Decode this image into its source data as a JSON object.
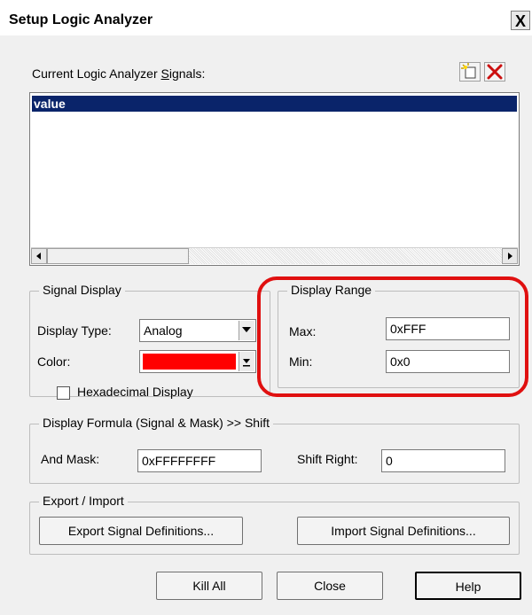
{
  "window": {
    "title": "Setup Logic Analyzer",
    "close_glyph": "X"
  },
  "signals": {
    "label_prefix": "Current Logic Analyzer ",
    "label_accel": "S",
    "label_suffix": "ignals:",
    "items": [
      "value"
    ],
    "selected_index": 0
  },
  "signal_display": {
    "legend": "Signal Display",
    "display_type_label": "Display Type:",
    "display_type_value": "Analog",
    "color_label": "Color:",
    "color_value": "#ff0000",
    "hex_label": "Hexadecimal Display",
    "hex_checked": false
  },
  "display_range": {
    "legend": "Display Range",
    "max_label": "Max:",
    "max_value": "0xFFF",
    "min_label": "Min:",
    "min_value": "0x0"
  },
  "formula": {
    "legend": "Display Formula (Signal & Mask) >> Shift",
    "and_mask_label": "And Mask:",
    "and_mask_value": "0xFFFFFFFF",
    "shift_right_label": "Shift Right:",
    "shift_right_value": "0"
  },
  "export_import": {
    "legend": "Export / Import",
    "export_label": "Export Signal Definitions...",
    "import_label": "Import Signal Definitions..."
  },
  "buttons": {
    "kill_all": "Kill All",
    "close": "Close",
    "help": "Help"
  },
  "annotation_color": "#e01010"
}
